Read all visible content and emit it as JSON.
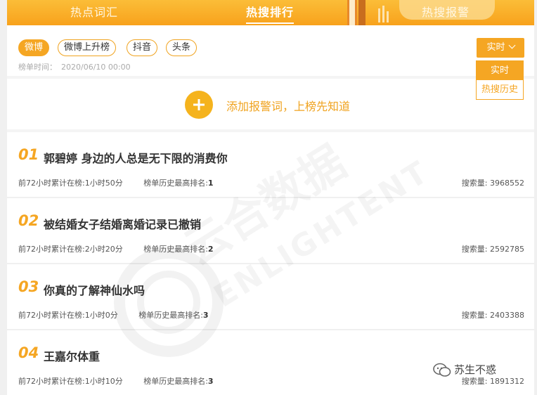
{
  "tabs": [
    {
      "label": "热点词汇",
      "active": false
    },
    {
      "label": "热搜排行",
      "active": true
    },
    {
      "label": "热搜报警",
      "active": false
    }
  ],
  "platforms": [
    {
      "label": "微博",
      "active": true
    },
    {
      "label": "微博上升榜",
      "active": false
    },
    {
      "label": "抖音",
      "active": false
    },
    {
      "label": "头条",
      "active": false
    }
  ],
  "rank_time": {
    "label": "榜单时间：",
    "value": "2020/06/10 00:00"
  },
  "mode_select": {
    "label": "实时"
  },
  "mode_options": [
    {
      "label": "实时",
      "selected": true
    },
    {
      "label": "热搜历史",
      "selected": false
    }
  ],
  "alert": {
    "text": "添加报警词，上榜先知道"
  },
  "items": [
    {
      "rank": "01",
      "title": "郭碧婷 身边的人总是无下限的消费你",
      "cum_label": "前72小时累计在榜:",
      "cum_value": "1小时50分",
      "hist_label": "榜单历史最高排名:",
      "hist_value": "1",
      "vol_label": "搜索量: ",
      "vol_value": "3968552"
    },
    {
      "rank": "02",
      "title": "被结婚女子结婚离婚记录已撤销",
      "cum_label": "前72小时累计在榜:",
      "cum_value": "2小时20分",
      "hist_label": "榜单历史最高排名:",
      "hist_value": "2",
      "vol_label": "搜索量: ",
      "vol_value": "2592785"
    },
    {
      "rank": "03",
      "title": "你真的了解神仙水吗",
      "cum_label": "前72小时累计在榜:",
      "cum_value": "1小时0分",
      "hist_label": "榜单历史最高排名:",
      "hist_value": "3",
      "vol_label": "搜索量: ",
      "vol_value": "2403388"
    },
    {
      "rank": "04",
      "title": "王嘉尔体重",
      "cum_label": "前72小时累计在榜:",
      "cum_value": "1小时10分",
      "hist_label": "榜单历史最高排名:",
      "hist_value": "3",
      "vol_label": "搜索量: ",
      "vol_value": "1891312"
    }
  ],
  "watermark": {
    "text_cn": "云合数据",
    "text_en": "ENLIGHTENT"
  },
  "wechat_tag": {
    "text": "苏生不惑"
  },
  "colors": {
    "accent": "#f5a623",
    "header_bg": "#f8a21c"
  }
}
